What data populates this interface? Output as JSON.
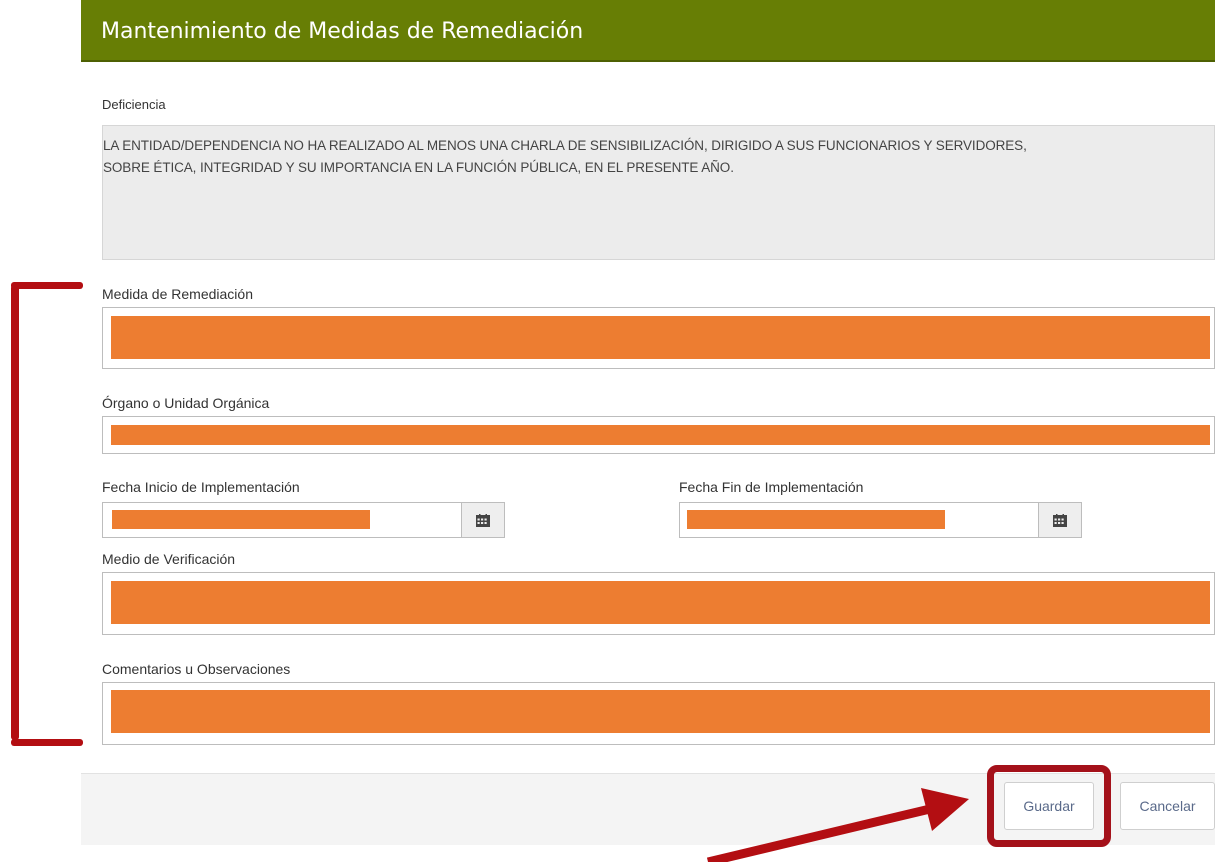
{
  "header": {
    "title": "Mantenimiento de Medidas de Remediación"
  },
  "deficiencia": {
    "label": "Deficiencia",
    "line1": "LA ENTIDAD/DEPENDENCIA NO HA REALIZADO AL MENOS UNA CHARLA DE SENSIBILIZACIÓN, DIRIGIDO A SUS FUNCIONARIOS Y SERVIDORES,",
    "line2": "SOBRE ÉTICA, INTEGRIDAD Y SU IMPORTANCIA EN LA FUNCIÓN PÚBLICA, EN EL PRESENTE AÑO."
  },
  "fields": {
    "medida_label": "Medida de Remediación",
    "organo_label": "Órgano o Unidad Orgánica",
    "fecha_inicio_label": "Fecha Inicio de Implementación",
    "fecha_fin_label": "Fecha Fin de Implementación",
    "medio_label": "Medio de Verificación",
    "comentarios_label": "Comentarios u Observaciones"
  },
  "icons": {
    "calendar": "calendar-icon"
  },
  "footer": {
    "guardar_label": "Guardar",
    "cancelar_label": "Cancelar"
  },
  "colors": {
    "header_bg": "#677e05",
    "redaction": "#ed7d31",
    "annotation": "#b30e12"
  }
}
